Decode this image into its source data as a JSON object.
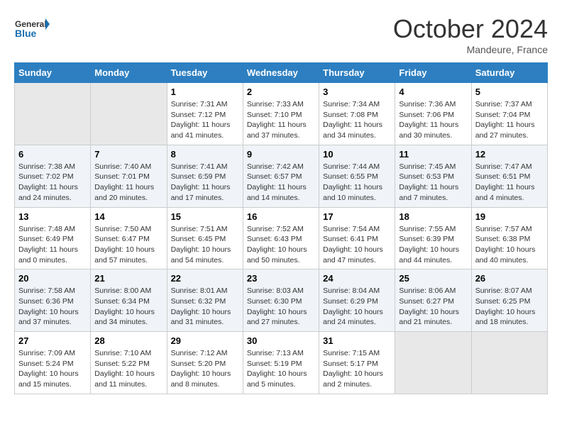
{
  "header": {
    "logo_general": "General",
    "logo_blue": "Blue",
    "month_title": "October 2024",
    "subtitle": "Mandeure, France"
  },
  "days_of_week": [
    "Sunday",
    "Monday",
    "Tuesday",
    "Wednesday",
    "Thursday",
    "Friday",
    "Saturday"
  ],
  "weeks": [
    [
      {
        "day": "",
        "empty": true
      },
      {
        "day": "",
        "empty": true
      },
      {
        "day": "1",
        "sunrise": "Sunrise: 7:31 AM",
        "sunset": "Sunset: 7:12 PM",
        "daylight": "Daylight: 11 hours and 41 minutes."
      },
      {
        "day": "2",
        "sunrise": "Sunrise: 7:33 AM",
        "sunset": "Sunset: 7:10 PM",
        "daylight": "Daylight: 11 hours and 37 minutes."
      },
      {
        "day": "3",
        "sunrise": "Sunrise: 7:34 AM",
        "sunset": "Sunset: 7:08 PM",
        "daylight": "Daylight: 11 hours and 34 minutes."
      },
      {
        "day": "4",
        "sunrise": "Sunrise: 7:36 AM",
        "sunset": "Sunset: 7:06 PM",
        "daylight": "Daylight: 11 hours and 30 minutes."
      },
      {
        "day": "5",
        "sunrise": "Sunrise: 7:37 AM",
        "sunset": "Sunset: 7:04 PM",
        "daylight": "Daylight: 11 hours and 27 minutes."
      }
    ],
    [
      {
        "day": "6",
        "sunrise": "Sunrise: 7:38 AM",
        "sunset": "Sunset: 7:02 PM",
        "daylight": "Daylight: 11 hours and 24 minutes."
      },
      {
        "day": "7",
        "sunrise": "Sunrise: 7:40 AM",
        "sunset": "Sunset: 7:01 PM",
        "daylight": "Daylight: 11 hours and 20 minutes."
      },
      {
        "day": "8",
        "sunrise": "Sunrise: 7:41 AM",
        "sunset": "Sunset: 6:59 PM",
        "daylight": "Daylight: 11 hours and 17 minutes."
      },
      {
        "day": "9",
        "sunrise": "Sunrise: 7:42 AM",
        "sunset": "Sunset: 6:57 PM",
        "daylight": "Daylight: 11 hours and 14 minutes."
      },
      {
        "day": "10",
        "sunrise": "Sunrise: 7:44 AM",
        "sunset": "Sunset: 6:55 PM",
        "daylight": "Daylight: 11 hours and 10 minutes."
      },
      {
        "day": "11",
        "sunrise": "Sunrise: 7:45 AM",
        "sunset": "Sunset: 6:53 PM",
        "daylight": "Daylight: 11 hours and 7 minutes."
      },
      {
        "day": "12",
        "sunrise": "Sunrise: 7:47 AM",
        "sunset": "Sunset: 6:51 PM",
        "daylight": "Daylight: 11 hours and 4 minutes."
      }
    ],
    [
      {
        "day": "13",
        "sunrise": "Sunrise: 7:48 AM",
        "sunset": "Sunset: 6:49 PM",
        "daylight": "Daylight: 11 hours and 0 minutes."
      },
      {
        "day": "14",
        "sunrise": "Sunrise: 7:50 AM",
        "sunset": "Sunset: 6:47 PM",
        "daylight": "Daylight: 10 hours and 57 minutes."
      },
      {
        "day": "15",
        "sunrise": "Sunrise: 7:51 AM",
        "sunset": "Sunset: 6:45 PM",
        "daylight": "Daylight: 10 hours and 54 minutes."
      },
      {
        "day": "16",
        "sunrise": "Sunrise: 7:52 AM",
        "sunset": "Sunset: 6:43 PM",
        "daylight": "Daylight: 10 hours and 50 minutes."
      },
      {
        "day": "17",
        "sunrise": "Sunrise: 7:54 AM",
        "sunset": "Sunset: 6:41 PM",
        "daylight": "Daylight: 10 hours and 47 minutes."
      },
      {
        "day": "18",
        "sunrise": "Sunrise: 7:55 AM",
        "sunset": "Sunset: 6:39 PM",
        "daylight": "Daylight: 10 hours and 44 minutes."
      },
      {
        "day": "19",
        "sunrise": "Sunrise: 7:57 AM",
        "sunset": "Sunset: 6:38 PM",
        "daylight": "Daylight: 10 hours and 40 minutes."
      }
    ],
    [
      {
        "day": "20",
        "sunrise": "Sunrise: 7:58 AM",
        "sunset": "Sunset: 6:36 PM",
        "daylight": "Daylight: 10 hours and 37 minutes."
      },
      {
        "day": "21",
        "sunrise": "Sunrise: 8:00 AM",
        "sunset": "Sunset: 6:34 PM",
        "daylight": "Daylight: 10 hours and 34 minutes."
      },
      {
        "day": "22",
        "sunrise": "Sunrise: 8:01 AM",
        "sunset": "Sunset: 6:32 PM",
        "daylight": "Daylight: 10 hours and 31 minutes."
      },
      {
        "day": "23",
        "sunrise": "Sunrise: 8:03 AM",
        "sunset": "Sunset: 6:30 PM",
        "daylight": "Daylight: 10 hours and 27 minutes."
      },
      {
        "day": "24",
        "sunrise": "Sunrise: 8:04 AM",
        "sunset": "Sunset: 6:29 PM",
        "daylight": "Daylight: 10 hours and 24 minutes."
      },
      {
        "day": "25",
        "sunrise": "Sunrise: 8:06 AM",
        "sunset": "Sunset: 6:27 PM",
        "daylight": "Daylight: 10 hours and 21 minutes."
      },
      {
        "day": "26",
        "sunrise": "Sunrise: 8:07 AM",
        "sunset": "Sunset: 6:25 PM",
        "daylight": "Daylight: 10 hours and 18 minutes."
      }
    ],
    [
      {
        "day": "27",
        "sunrise": "Sunrise: 7:09 AM",
        "sunset": "Sunset: 5:24 PM",
        "daylight": "Daylight: 10 hours and 15 minutes."
      },
      {
        "day": "28",
        "sunrise": "Sunrise: 7:10 AM",
        "sunset": "Sunset: 5:22 PM",
        "daylight": "Daylight: 10 hours and 11 minutes."
      },
      {
        "day": "29",
        "sunrise": "Sunrise: 7:12 AM",
        "sunset": "Sunset: 5:20 PM",
        "daylight": "Daylight: 10 hours and 8 minutes."
      },
      {
        "day": "30",
        "sunrise": "Sunrise: 7:13 AM",
        "sunset": "Sunset: 5:19 PM",
        "daylight": "Daylight: 10 hours and 5 minutes."
      },
      {
        "day": "31",
        "sunrise": "Sunrise: 7:15 AM",
        "sunset": "Sunset: 5:17 PM",
        "daylight": "Daylight: 10 hours and 2 minutes."
      },
      {
        "day": "",
        "empty": true
      },
      {
        "day": "",
        "empty": true
      }
    ]
  ]
}
